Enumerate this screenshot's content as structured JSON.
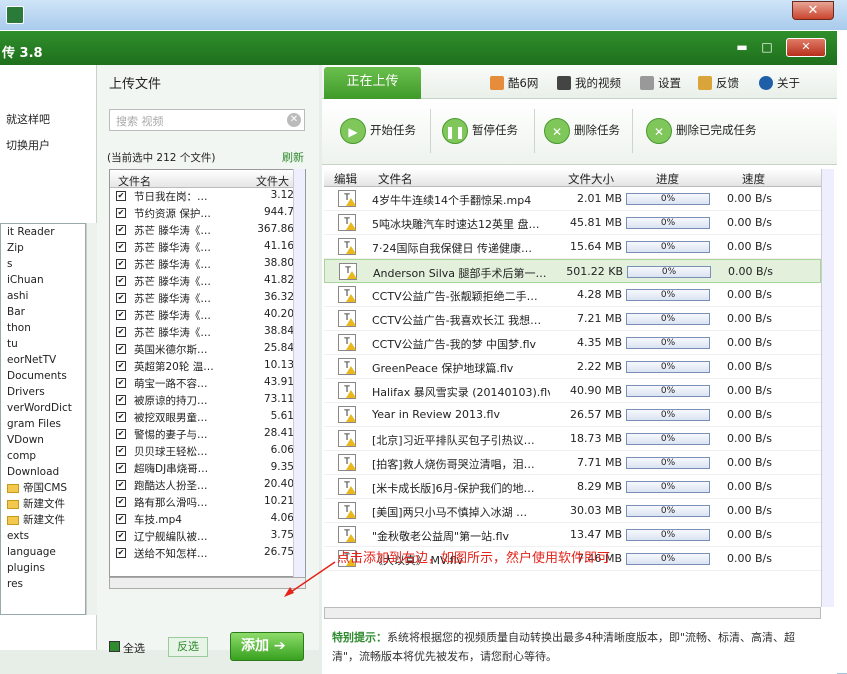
{
  "app": {
    "title": "传 3.8"
  },
  "left_menu": [
    "就这样吧",
    "切换用户"
  ],
  "tree": [
    "it Reader",
    "Zip",
    "s",
    "iChuan",
    "ashi",
    "Bar",
    "thon",
    "tu",
    "eorNetTV",
    "Documents",
    "Drivers",
    "verWordDict",
    "gram Files",
    "VDown",
    "comp",
    "Download",
    "帝国CMS",
    "新建文件",
    "新建文件",
    "exts",
    "language",
    "plugins",
    "res"
  ],
  "upload_panel": {
    "title": "上传文件",
    "search_placeholder": "搜索 视频",
    "count_text": "(当前选中 212 个文件)",
    "refresh": "刷新",
    "col_name": "文件名",
    "col_size": "文件大",
    "files": [
      {
        "name": "节日我在岗：…",
        "size": "3.12"
      },
      {
        "name": "节约资源 保护…",
        "size": "944.7"
      },
      {
        "name": "苏芒 滕华涛《…",
        "size": "367.86"
      },
      {
        "name": "苏芒 滕华涛《…",
        "size": "41.16"
      },
      {
        "name": "苏芒 滕华涛《…",
        "size": "38.80"
      },
      {
        "name": "苏芒 滕华涛《…",
        "size": "41.82"
      },
      {
        "name": "苏芒 滕华涛《…",
        "size": "36.32"
      },
      {
        "name": "苏芒 滕华涛《…",
        "size": "40.20"
      },
      {
        "name": "苏芒 滕华涛《…",
        "size": "38.84"
      },
      {
        "name": "英国米德尔斯…",
        "size": "25.84"
      },
      {
        "name": "英超第20轮 温…",
        "size": "10.13"
      },
      {
        "name": "萌宝一路不容…",
        "size": "43.91"
      },
      {
        "name": "被原谅的持刀…",
        "size": "73.11"
      },
      {
        "name": "被挖双眼男童…",
        "size": "5.61"
      },
      {
        "name": "警惕的妻子与…",
        "size": "28.41"
      },
      {
        "name": "贝贝球王轻松…",
        "size": "6.06"
      },
      {
        "name": "超嗨DJ串烧哥…",
        "size": "9.35"
      },
      {
        "name": "跑酷达人扮圣…",
        "size": "20.40"
      },
      {
        "name": "路有那么滑吗…",
        "size": "10.21"
      },
      {
        "name": "车技.mp4",
        "size": "4.06"
      },
      {
        "name": "辽宁舰编队被…",
        "size": "3.75"
      },
      {
        "name": "送给不知怎样…",
        "size": "26.75"
      }
    ],
    "select_all": "全选",
    "invert": "反选",
    "add": "添加"
  },
  "tabs": {
    "uploading": "正在上传"
  },
  "top_links": [
    "酷6网",
    "我的视频",
    "设置",
    "反馈",
    "关于"
  ],
  "toolbar": {
    "start": "开始任务",
    "pause": "暂停任务",
    "delete": "删除任务",
    "delete_done": "删除已完成任务"
  },
  "queue": {
    "headers": {
      "edit": "编辑",
      "name": "文件名",
      "size": "文件大小",
      "progress": "进度",
      "speed": "速度"
    },
    "rows": [
      {
        "name": "4岁牛牛连续14个手翻惊呆.mp4",
        "size": "2.01 MB",
        "progress": "0%",
        "speed": "0.00 B/s"
      },
      {
        "name": "5吨冰块雕汽车时速达12英里 盘…",
        "size": "45.81 MB",
        "progress": "0%",
        "speed": "0.00 B/s"
      },
      {
        "name": "7·24国际自我保健日 传递健康…",
        "size": "15.64 MB",
        "progress": "0%",
        "speed": "0.00 B/s"
      },
      {
        "name": "Anderson Silva 腿部手术后第一…",
        "size": "501.22 KB",
        "progress": "0%",
        "speed": "0.00 B/s"
      },
      {
        "name": "CCTV公益广告-张靓颖拒绝二手…",
        "size": "4.28 MB",
        "progress": "0%",
        "speed": "0.00 B/s"
      },
      {
        "name": "CCTV公益广告-我喜欢长江 我想…",
        "size": "7.21 MB",
        "progress": "0%",
        "speed": "0.00 B/s"
      },
      {
        "name": "CCTV公益广告-我的梦 中国梦.flv",
        "size": "4.35 MB",
        "progress": "0%",
        "speed": "0.00 B/s"
      },
      {
        "name": "GreenPeace 保护地球篇.flv",
        "size": "2.22 MB",
        "progress": "0%",
        "speed": "0.00 B/s"
      },
      {
        "name": "Halifax 暴风雪实录 (20140103).flv",
        "size": "40.90 MB",
        "progress": "0%",
        "speed": "0.00 B/s"
      },
      {
        "name": "Year in Review 2013.flv",
        "size": "26.57 MB",
        "progress": "0%",
        "speed": "0.00 B/s"
      },
      {
        "name": "[北京]习近平排队买包子引热议…",
        "size": "18.73 MB",
        "progress": "0%",
        "speed": "0.00 B/s"
      },
      {
        "name": "[拍客]救人烧伤哥哭泣清唱，泪…",
        "size": "7.71 MB",
        "progress": "0%",
        "speed": "0.00 B/s"
      },
      {
        "name": "[米卡成长版]6月-保护我们的地…",
        "size": "8.29 MB",
        "progress": "0%",
        "speed": "0.00 B/s"
      },
      {
        "name": "[美国]两只小马不慎掉入冰湖 …",
        "size": "30.03 MB",
        "progress": "0%",
        "speed": "0.00 B/s"
      },
      {
        "name": "\"金秋敬老公益周\"第一站.flv",
        "size": "13.47 MB",
        "progress": "0%",
        "speed": "0.00 B/s"
      },
      {
        "name": "《大以真》 MV.flv",
        "size": "7.46 MB",
        "progress": "0%",
        "speed": "0.00 B/s"
      }
    ]
  },
  "tip": {
    "label": "特别提示：",
    "text": "系统将根据您的视频质量自动转换出最多4种清晰度版本，即\"流畅、标清、高清、超清\"，流畅版本将优先被发布，请您耐心等待。"
  },
  "annotation": "点击添加到右边，如图所示，然户使用软件即可"
}
